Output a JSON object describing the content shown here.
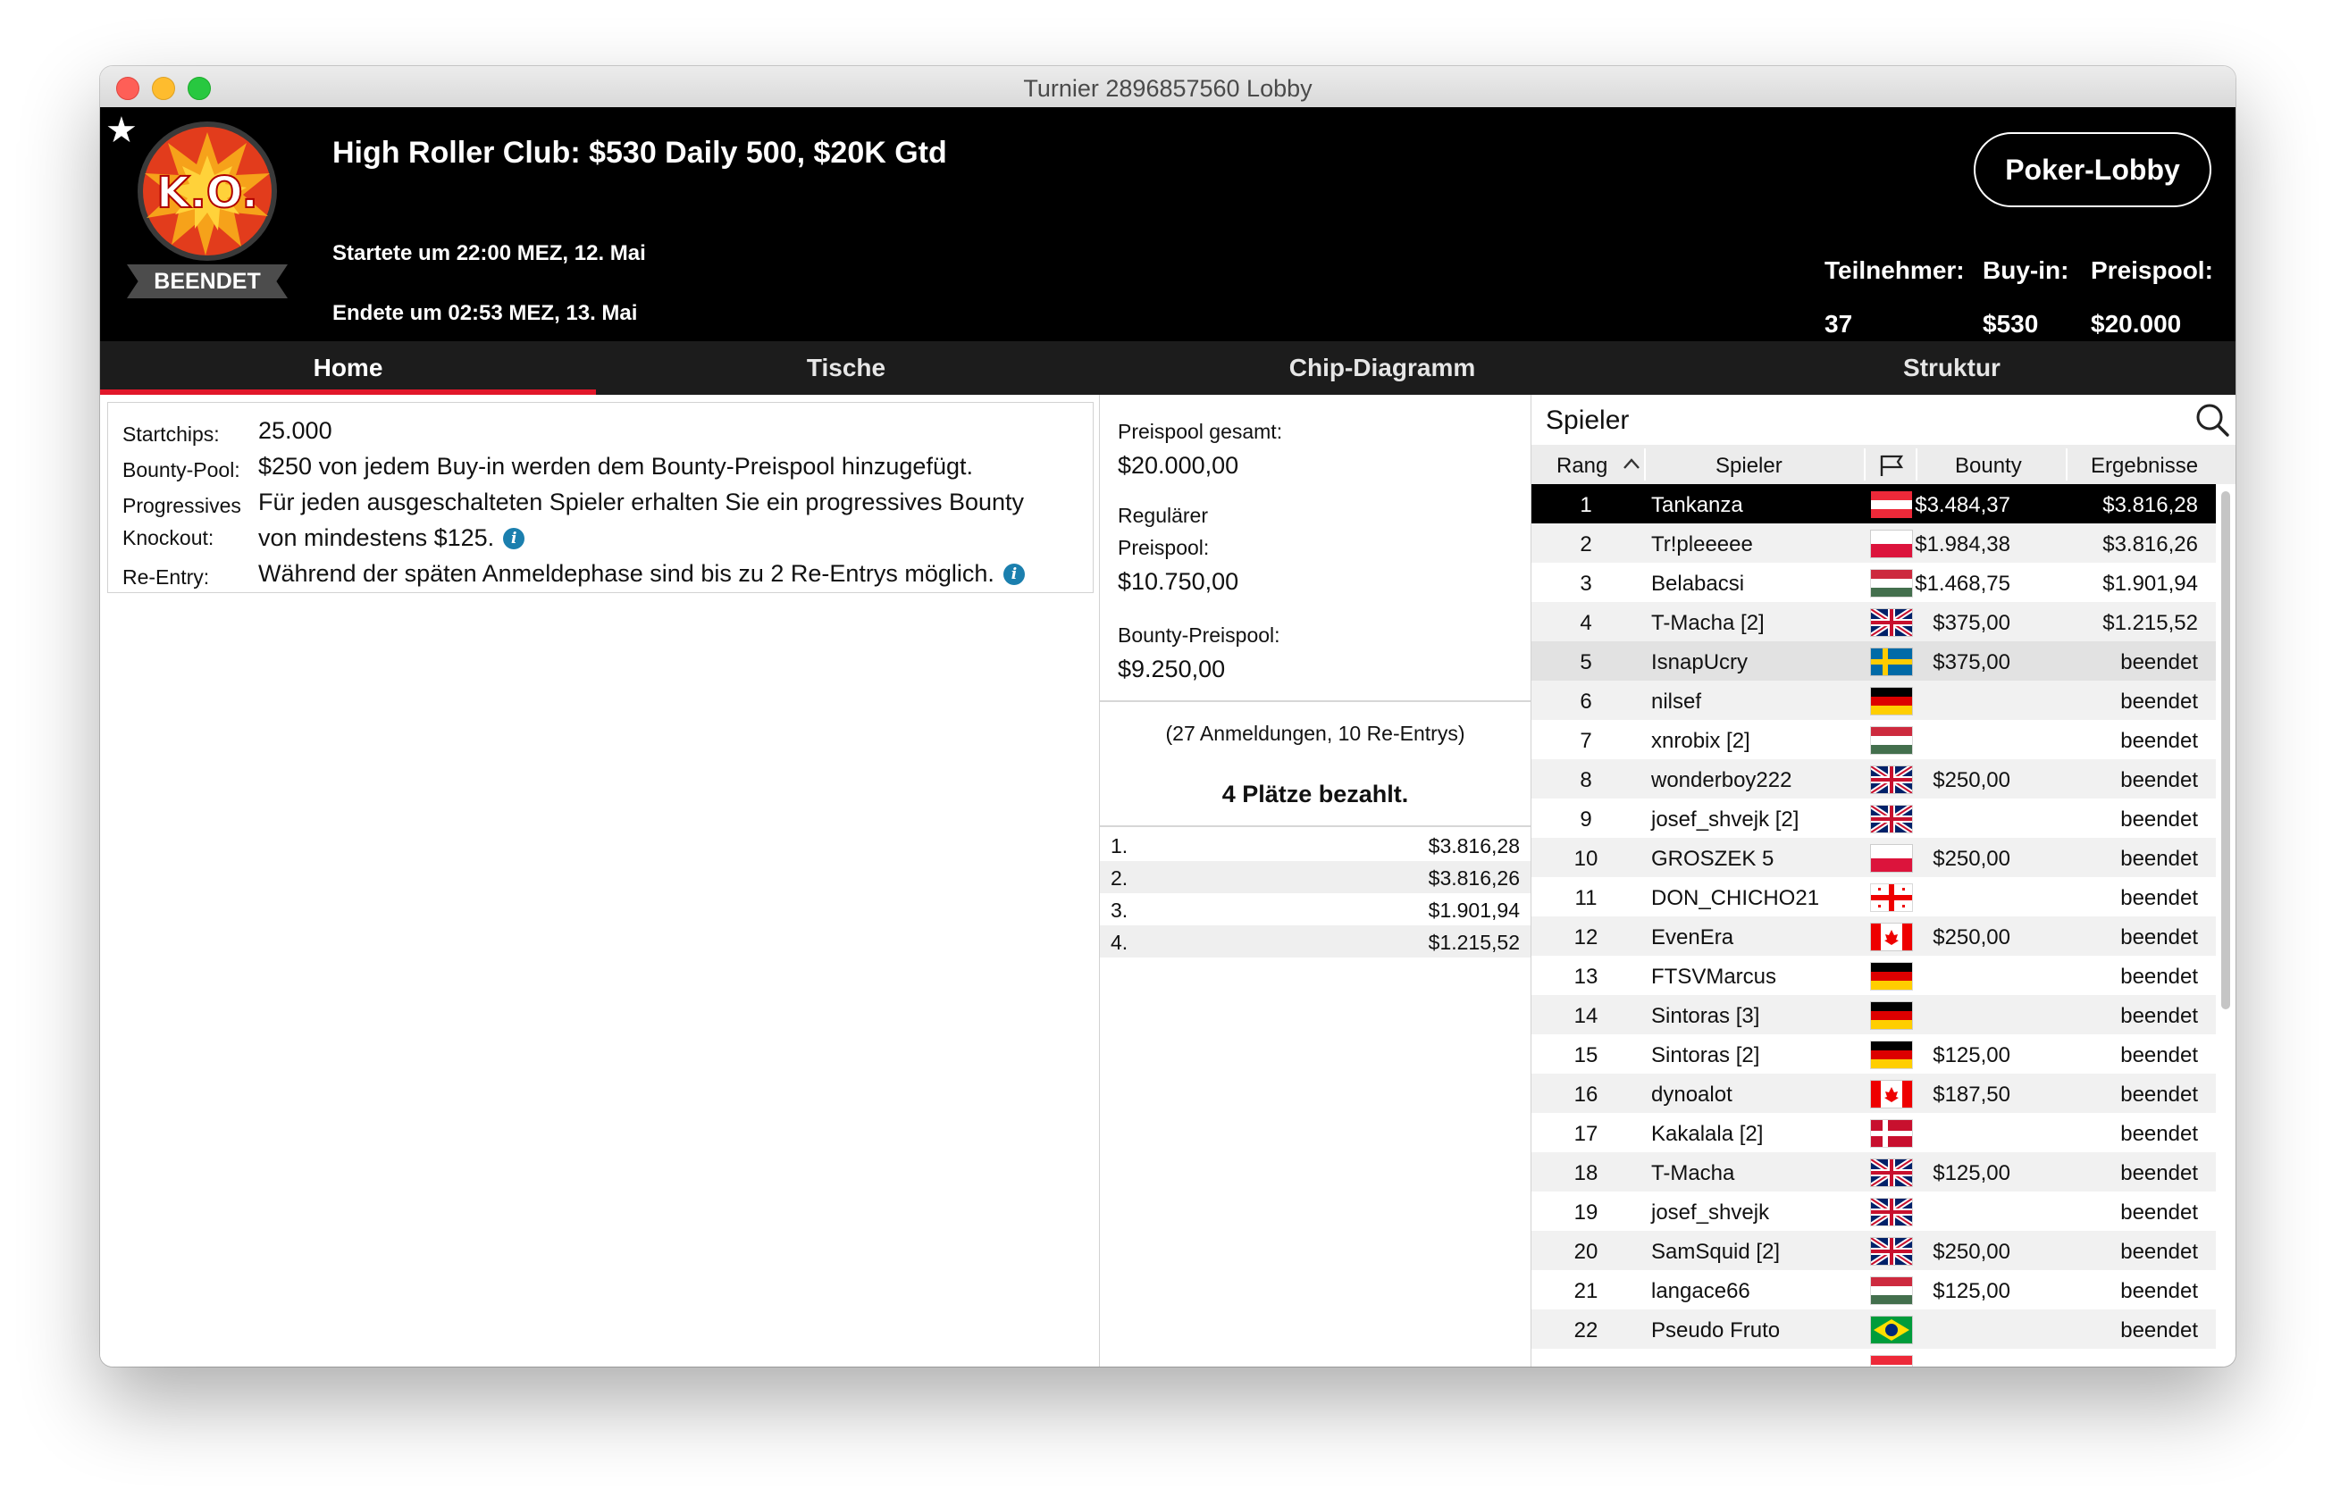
{
  "window": {
    "title": "Turnier 2896857560 Lobby"
  },
  "header": {
    "logo_text": "K.O.",
    "status": "BEENDET",
    "title": "High Roller Club: $530 Daily 500, $20K Gtd",
    "started": "Startete um 22:00 MEZ, 12. Mai",
    "ended": "Endete um 02:53 MEZ, 13. Mai",
    "lobby_button": "Poker-Lobby",
    "stats": {
      "players_label": "Teilnehmer:",
      "players_value": "37",
      "buyin_label": "Buy-in:",
      "buyin_value": "$530",
      "prizepool_label": "Preispool:",
      "prizepool_value": "$20.000"
    }
  },
  "tabs": [
    {
      "label": "Home",
      "active": true
    },
    {
      "label": "Tische"
    },
    {
      "label": "Chip-Diagramm"
    },
    {
      "label": "Struktur"
    }
  ],
  "details": {
    "startchips_label": "Startchips:",
    "startchips_value": "25.000",
    "bountypool_label": "Bounty-Pool:",
    "bountypool_value": "$250 von jedem Buy-in werden dem Bounty-Preispool hinzugefügt.",
    "progressive_label_1": "Progressives",
    "progressive_label_2": "Knockout:",
    "progressive_value_1": "Für jeden ausgeschalteten Spieler erhalten Sie ein progressives Bounty",
    "progressive_value_2": "von mindestens $125.",
    "reentry_label": "Re-Entry:",
    "reentry_value": "Während der späten Anmeldephase sind bis zu 2 Re-Entrys möglich."
  },
  "prizepool": {
    "total_label": "Preispool gesamt:",
    "total_value": "$20.000,00",
    "regular_label_1": "Regulärer",
    "regular_label_2": "Preispool:",
    "regular_value": "$10.750,00",
    "bounty_label": "Bounty-Preispool:",
    "bounty_value": "$9.250,00",
    "registrations": "(27 Anmeldungen, 10 Re-Entrys)",
    "paid": "4 Plätze bezahlt.",
    "payouts": [
      {
        "place": "1.",
        "amount": "$3.816,28"
      },
      {
        "place": "2.",
        "amount": "$3.816,26"
      },
      {
        "place": "3.",
        "amount": "$1.901,94"
      },
      {
        "place": "4.",
        "amount": "$1.215,52"
      }
    ]
  },
  "players": {
    "title": "Spieler",
    "columns": {
      "rank": "Rang",
      "player": "Spieler",
      "bounty": "Bounty",
      "result": "Ergebnisse"
    },
    "rows": [
      {
        "rank": "1",
        "name": "Tankanza",
        "flag": "AT",
        "bounty": "$3.484,37",
        "result": "$3.816,28"
      },
      {
        "rank": "2",
        "name": "Tr!pleeeee",
        "flag": "PL",
        "bounty": "$1.984,38",
        "result": "$3.816,26"
      },
      {
        "rank": "3",
        "name": "Belabacsi",
        "flag": "HU",
        "bounty": "$1.468,75",
        "result": "$1.901,94"
      },
      {
        "rank": "4",
        "name": "T-Macha [2]",
        "flag": "GB",
        "bounty": "$375,00",
        "result": "$1.215,52"
      },
      {
        "rank": "5",
        "name": "IsnapUcry",
        "flag": "SE",
        "bounty": "$375,00",
        "result": "beendet"
      },
      {
        "rank": "6",
        "name": "nilsef",
        "flag": "DE",
        "bounty": "",
        "result": "beendet"
      },
      {
        "rank": "7",
        "name": "xnrobix [2]",
        "flag": "HU",
        "bounty": "",
        "result": "beendet"
      },
      {
        "rank": "8",
        "name": "wonderboy222",
        "flag": "GB",
        "bounty": "$250,00",
        "result": "beendet"
      },
      {
        "rank": "9",
        "name": "josef_shvejk [2]",
        "flag": "GB",
        "bounty": "",
        "result": "beendet"
      },
      {
        "rank": "10",
        "name": "GROSZEK 5",
        "flag": "PL",
        "bounty": "$250,00",
        "result": "beendet"
      },
      {
        "rank": "11",
        "name": "DON_CHICHO21",
        "flag": "GE",
        "bounty": "",
        "result": "beendet"
      },
      {
        "rank": "12",
        "name": "EvenEra",
        "flag": "CA",
        "bounty": "$250,00",
        "result": "beendet"
      },
      {
        "rank": "13",
        "name": "FTSVMarcus",
        "flag": "DE",
        "bounty": "",
        "result": "beendet"
      },
      {
        "rank": "14",
        "name": "Sintoras [3]",
        "flag": "DE",
        "bounty": "",
        "result": "beendet"
      },
      {
        "rank": "15",
        "name": "Sintoras [2]",
        "flag": "DE",
        "bounty": "$125,00",
        "result": "beendet"
      },
      {
        "rank": "16",
        "name": "dynoalot",
        "flag": "CA",
        "bounty": "$187,50",
        "result": "beendet"
      },
      {
        "rank": "17",
        "name": "Kakalala [2]",
        "flag": "DK",
        "bounty": "",
        "result": "beendet"
      },
      {
        "rank": "18",
        "name": "T-Macha",
        "flag": "GB",
        "bounty": "$125,00",
        "result": "beendet"
      },
      {
        "rank": "19",
        "name": "josef_shvejk",
        "flag": "GB",
        "bounty": "",
        "result": "beendet"
      },
      {
        "rank": "20",
        "name": "SamSquid [2]",
        "flag": "GB",
        "bounty": "$250,00",
        "result": "beendet"
      },
      {
        "rank": "21",
        "name": "langace66",
        "flag": "HU",
        "bounty": "$125,00",
        "result": "beendet"
      },
      {
        "rank": "22",
        "name": "Pseudo Fruto",
        "flag": "BR",
        "bounty": "",
        "result": "beendet"
      },
      {
        "rank": "",
        "name": "",
        "flag": "AT",
        "bounty": "",
        "result": ""
      }
    ]
  },
  "colors": {
    "accent": "#e1172a",
    "header_bg": "#000000",
    "tabbar_bg": "#1c1c1c",
    "info": "#1b7fae"
  }
}
